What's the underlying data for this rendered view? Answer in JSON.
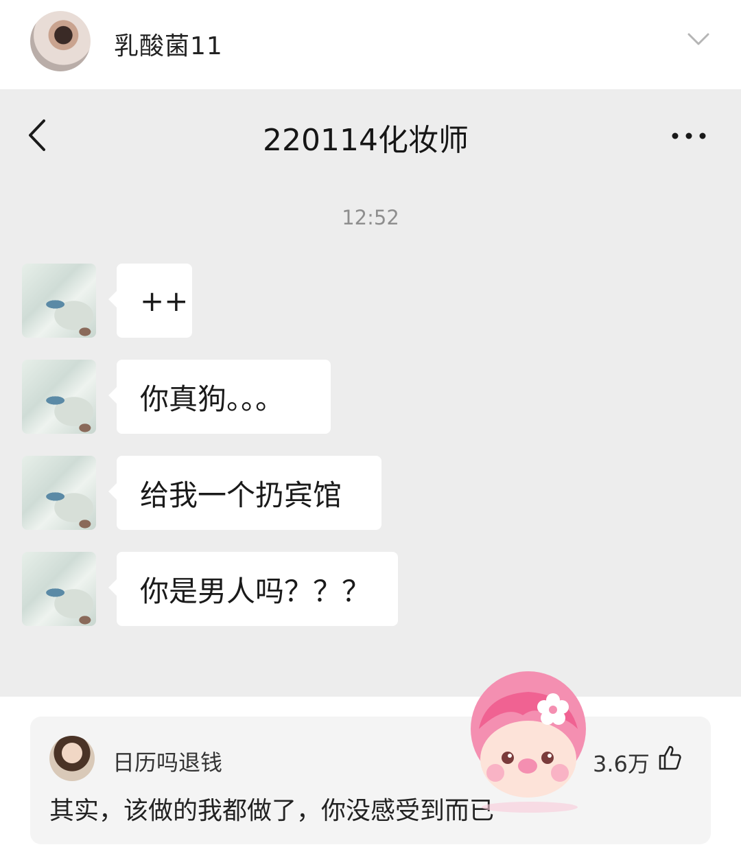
{
  "post": {
    "username": "乳酸菌11",
    "avatar_icon": "user-avatar",
    "chevron_icon": "chevron-down-icon"
  },
  "chat": {
    "title": "220114化妆师",
    "time": "12:52",
    "back_icon": "chevron-left-icon",
    "more_icon": "more-dots-icon",
    "messages": [
      {
        "text": "++"
      },
      {
        "text": "你真狗。。。"
      },
      {
        "text": "给我一个扔宾馆"
      },
      {
        "text": "你是男人吗？？？"
      }
    ]
  },
  "comment": {
    "username": "日历吗退钱",
    "likes": "3.6万",
    "like_icon": "thumbs-up-icon",
    "text": "其实，该做的我都做了，你没感受到而已"
  },
  "colors": {
    "chat_bg": "#ededed",
    "bubble": "#ffffff",
    "comment_card": "#f4f4f4",
    "sticker_pink": "#f48fb1"
  }
}
